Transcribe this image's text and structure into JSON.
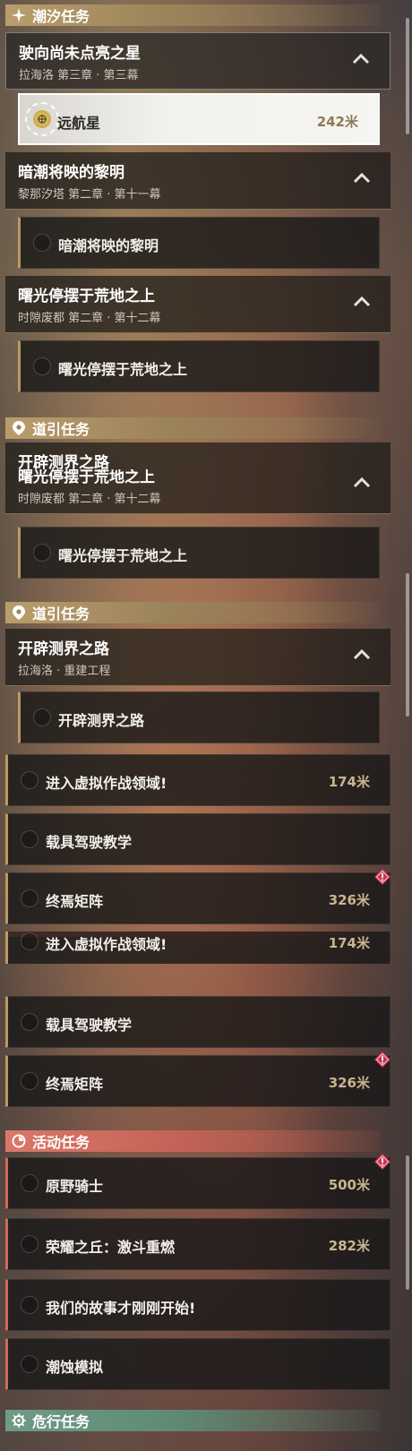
{
  "sections": {
    "tide": {
      "title": "潮汐任务"
    },
    "guide": {
      "title": "道引任务"
    },
    "event": {
      "title": "活动任务"
    },
    "danger": {
      "title": "危行任务"
    }
  },
  "tide_groups": [
    {
      "title": "驶向尚未点亮之星",
      "subtitle": "拉海洛 第三章 · 第三幕"
    },
    {
      "title": "暗潮将映的黎明",
      "subtitle": "黎那汐塔 第二章 · 第十一幕"
    },
    {
      "title": "曙光停摆于荒地之上",
      "subtitle": "时隙废都 第二章 · 第十二幕"
    }
  ],
  "tide_items": [
    {
      "label": "远航星",
      "distance": "242米"
    },
    {
      "label": "暗潮将映的黎明",
      "distance": ""
    },
    {
      "label": "曙光停摆于荒地之上",
      "distance": ""
    }
  ],
  "guide_group": {
    "title": "开辟测界之路",
    "subtitle": "拉海洛 · 重建工程"
  },
  "guide_items": [
    {
      "label": "开辟测界之路",
      "distance": ""
    },
    {
      "label": "进入虚拟作战领域!",
      "distance": "174米"
    },
    {
      "label": "载具驾驶教学",
      "distance": ""
    },
    {
      "label": "终焉矩阵",
      "distance": "326米"
    }
  ],
  "event_items": [
    {
      "label": "原野骑士",
      "distance": "500米"
    },
    {
      "label": "荣耀之丘：激斗重燃",
      "distance": "282米"
    },
    {
      "label": "我们的故事才刚刚开始!",
      "distance": ""
    },
    {
      "label": "潮蚀模拟",
      "distance": ""
    }
  ],
  "colors": {
    "tide_accent": "#b99d6c",
    "event_accent": "#d9786a",
    "danger_accent": "#6f9b86",
    "distance": "#c8b690"
  }
}
